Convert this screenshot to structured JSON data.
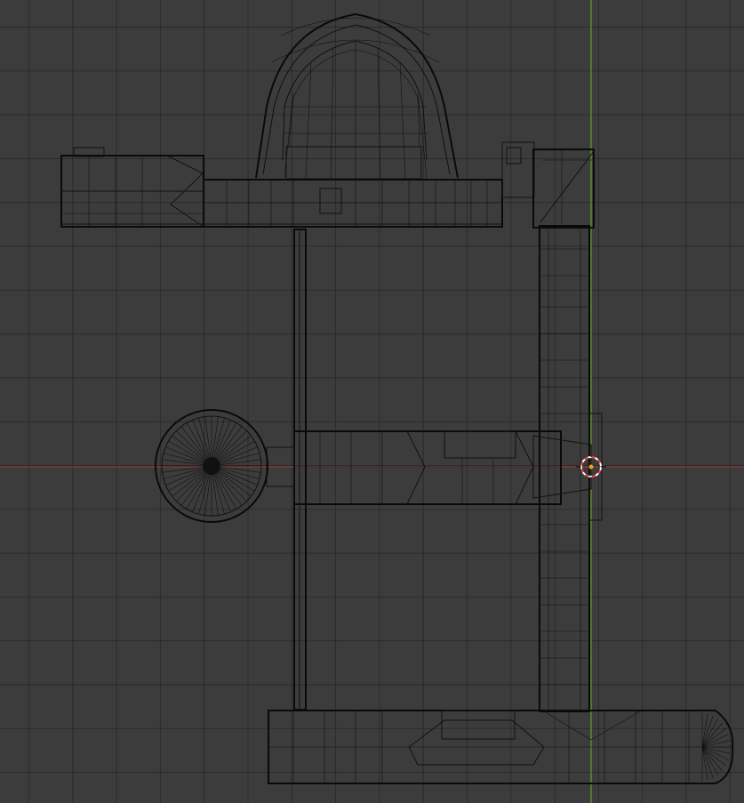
{
  "viewport": {
    "type": "3d-viewport-top-orthographic",
    "display_mode": "wireframe",
    "grid": true,
    "colors": {
      "background": "#3c3c3c",
      "grid_line": "#2f2f2f",
      "wire": "#111111",
      "x_axis": "#8a3a3a",
      "y_axis": "#6b9a2e",
      "cursor_ring_red": "#ff3b3b",
      "cursor_ring_white": "#ffffff",
      "origin_dot": "#f0a020"
    },
    "icons": {
      "cursor": "3d-cursor-icon",
      "origin": "object-origin-icon"
    }
  }
}
